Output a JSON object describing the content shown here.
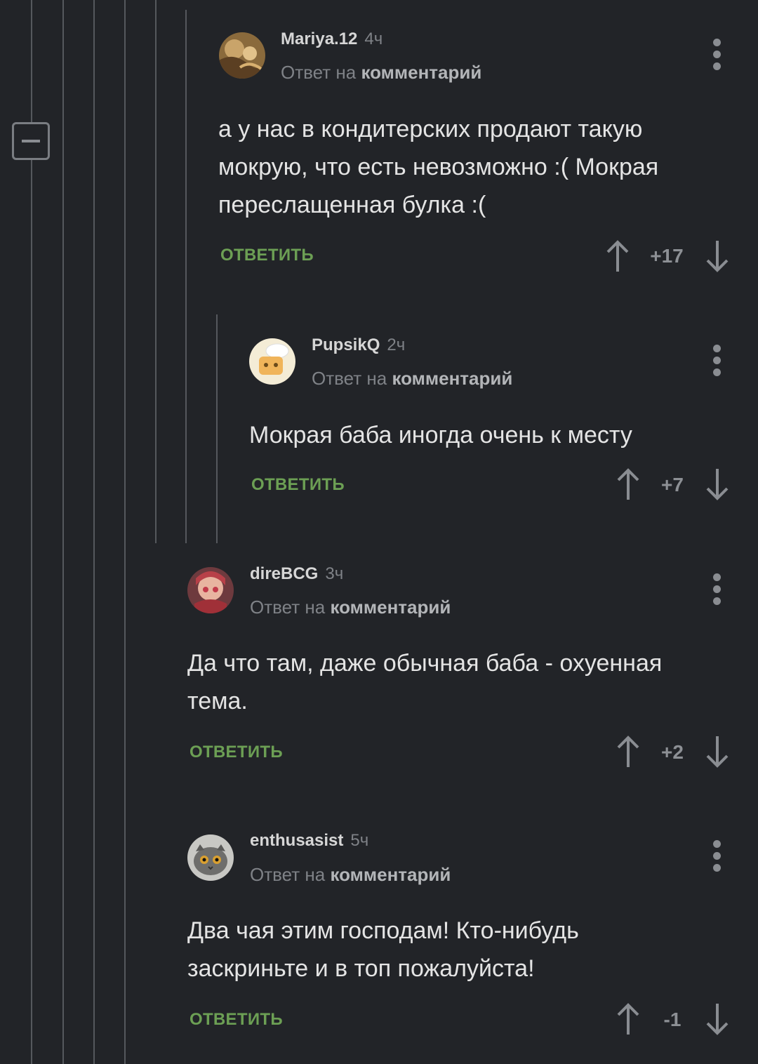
{
  "comments": [
    {
      "author": "Mariya.12",
      "time": "4ч",
      "reply_prefix": "Ответ на",
      "reply_link": "комментарий",
      "text": "а у нас в кондитерских продают такую мокрую, что есть невозможно :( Мокрая переслащенная булка :(",
      "reply_label": "ОТВЕТИТЬ",
      "rating": "+17"
    },
    {
      "author": "PupsikQ",
      "time": "2ч",
      "reply_prefix": "Ответ на",
      "reply_link": "комментарий",
      "text": "Мокрая баба иногда очень к месту",
      "reply_label": "ОТВЕТИТЬ",
      "rating": "+7"
    },
    {
      "author": "direBCG",
      "time": "3ч",
      "reply_prefix": "Ответ на",
      "reply_link": "комментарий",
      "text": "Да что там, даже обычная баба - охуенная тема.",
      "reply_label": "ОТВЕТИТЬ",
      "rating": "+2"
    },
    {
      "author": "enthusasist",
      "time": "5ч",
      "reply_prefix": "Ответ на",
      "reply_link": "комментарий",
      "text": "Два чая этим господам! Кто-нибудь заскриньте и в топ пожалуйста!",
      "reply_label": "ОТВЕТИТЬ",
      "rating": "-1"
    }
  ],
  "icons": {
    "collapse": "minus-square-icon",
    "menu": "more-vertical-icon",
    "upvote": "arrow-up-icon",
    "downvote": "arrow-down-icon"
  },
  "colors": {
    "background": "#222428",
    "accent_green": "#6c9f54",
    "thread_line": "#55585d"
  }
}
